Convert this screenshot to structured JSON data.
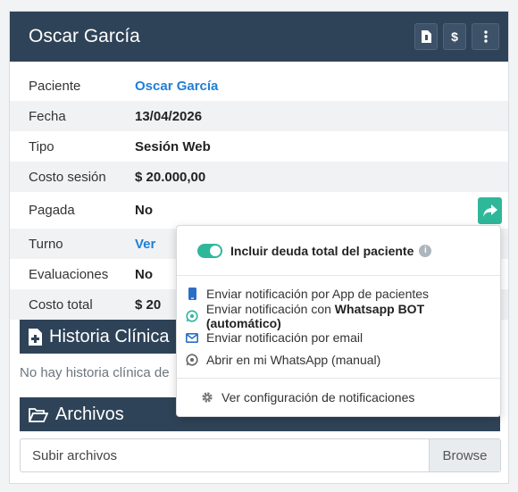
{
  "header": {
    "title": "Oscar García"
  },
  "rows": [
    {
      "label": "Paciente",
      "value": "Oscar García"
    },
    {
      "label": "Fecha",
      "value": "13/04/2026"
    },
    {
      "label": "Tipo",
      "value": "Sesión Web"
    },
    {
      "label": "Costo sesión",
      "value": "$ 20.000,00"
    },
    {
      "label": "Pagada",
      "value": "No"
    },
    {
      "label": "Turno",
      "value": "Ver"
    },
    {
      "label": "Evaluaciones",
      "value": "No"
    },
    {
      "label": "Costo total",
      "value": "$ 20"
    }
  ],
  "sections": {
    "historia": "Historia Clínica",
    "historia_empty": "No hay historia clínica de",
    "archivos": "Archivos"
  },
  "upload": {
    "placeholder": "Subir archivos",
    "browse": "Browse"
  },
  "dropdown": {
    "toggle_label": "Incluir deuda total del paciente",
    "items": [
      {
        "text": "Enviar notificación por App de pacientes",
        "icon": "mobile-icon"
      },
      {
        "text_prefix": "Enviar notificación con ",
        "text_bold": "Whatsapp BOT (automático)",
        "icon": "whatsapp-icon"
      },
      {
        "text": "Enviar notificación por email",
        "icon": "envelope-icon"
      },
      {
        "text": "Abrir en mi WhatsApp (manual)",
        "icon": "whatsapp-icon"
      }
    ],
    "config": "Ver configuración de notificaciones"
  },
  "colors": {
    "header": "#2f4358",
    "accent": "#2fb79a",
    "link": "#1f7fd6"
  }
}
